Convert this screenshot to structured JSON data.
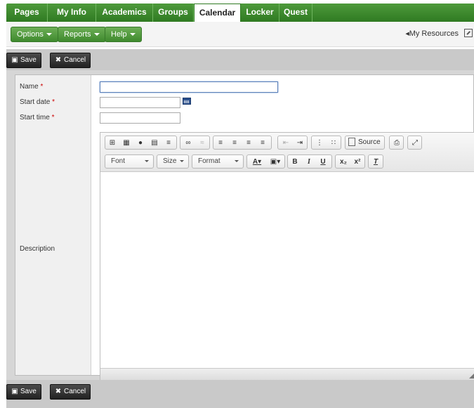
{
  "tabs": [
    {
      "label": "Pages",
      "active": false
    },
    {
      "label": "My Info",
      "active": false
    },
    {
      "label": "Academics",
      "active": false
    },
    {
      "label": "Groups",
      "active": false
    },
    {
      "label": "Calendar",
      "active": true
    },
    {
      "label": "Locker",
      "active": false
    },
    {
      "label": "Quest",
      "active": false
    }
  ],
  "toolbar": {
    "options_label": "Options",
    "reports_label": "Reports",
    "help_label": "Help",
    "my_resources_label": "My Resources"
  },
  "actions": {
    "save_label": "Save",
    "cancel_label": "Cancel"
  },
  "form": {
    "name_label": "Name",
    "start_date_label": "Start date",
    "start_time_label": "Start time",
    "description_label": "Description",
    "required_marker": "*",
    "name_value": "",
    "start_date_value": "",
    "start_time_value": ""
  },
  "editor": {
    "font_label": "Font",
    "size_label": "Size",
    "format_label": "Format",
    "source_label": "Source",
    "bold_label": "B",
    "italic_label": "I",
    "underline_label": "U",
    "text_color_label": "A",
    "content": ""
  },
  "colors": {
    "tab_bar_green": "#2f7a22",
    "button_green": "#4f9a3c",
    "dark_button": "#333333",
    "focus_border": "#5a7fb8",
    "required_red": "#cc0000"
  }
}
